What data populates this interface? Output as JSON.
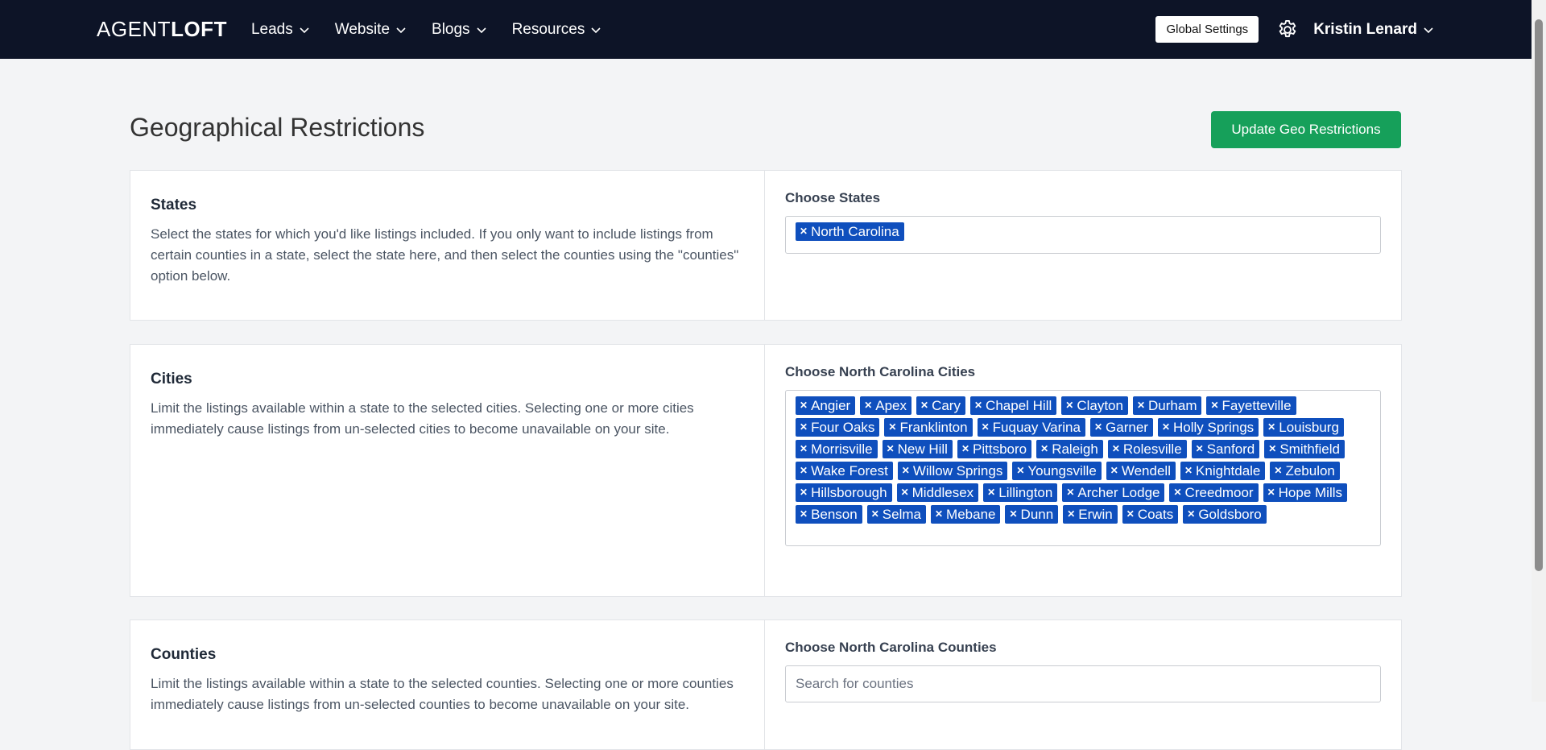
{
  "brand": {
    "prefix": "AGENT",
    "bold": "LOFT"
  },
  "nav": [
    {
      "label": "Leads"
    },
    {
      "label": "Website"
    },
    {
      "label": "Blogs"
    },
    {
      "label": "Resources"
    }
  ],
  "header": {
    "global_settings_label": "Global Settings",
    "user_name": "Kristin Lenard"
  },
  "page": {
    "title": "Geographical Restrictions",
    "update_button": "Update Geo Restrictions"
  },
  "states": {
    "heading": "States",
    "description": "Select the states for which you'd like listings included. If you only want to include listings from certain counties in a state, select the state here, and then select the counties using the \"counties\" option below.",
    "choose_label": "Choose States",
    "selected": [
      "North Carolina"
    ]
  },
  "cities": {
    "heading": "Cities",
    "description": "Limit the listings available within a state to the selected cities. Selecting one or more cities immediately cause listings from un-selected cities to become unavailable on your site.",
    "choose_label": "Choose North Carolina Cities",
    "selected": [
      "Angier",
      "Apex",
      "Cary",
      "Chapel Hill",
      "Clayton",
      "Durham",
      "Fayetteville",
      "Four Oaks",
      "Franklinton",
      "Fuquay Varina",
      "Garner",
      "Holly Springs",
      "Louisburg",
      "Morrisville",
      "New Hill",
      "Pittsboro",
      "Raleigh",
      "Rolesville",
      "Sanford",
      "Smithfield",
      "Wake Forest",
      "Willow Springs",
      "Youngsville",
      "Wendell",
      "Knightdale",
      "Zebulon",
      "Hillsborough",
      "Middlesex",
      "Lillington",
      "Archer Lodge",
      "Creedmoor",
      "Hope Mills",
      "Benson",
      "Selma",
      "Mebane",
      "Dunn",
      "Erwin",
      "Coats",
      "Goldsboro"
    ]
  },
  "counties": {
    "heading": "Counties",
    "description": "Limit the listings available within a state to the selected counties. Selecting one or more counties immediately cause listings from un-selected counties to become unavailable on your site.",
    "choose_label": "Choose North Carolina Counties",
    "search_placeholder": "Search for counties"
  }
}
